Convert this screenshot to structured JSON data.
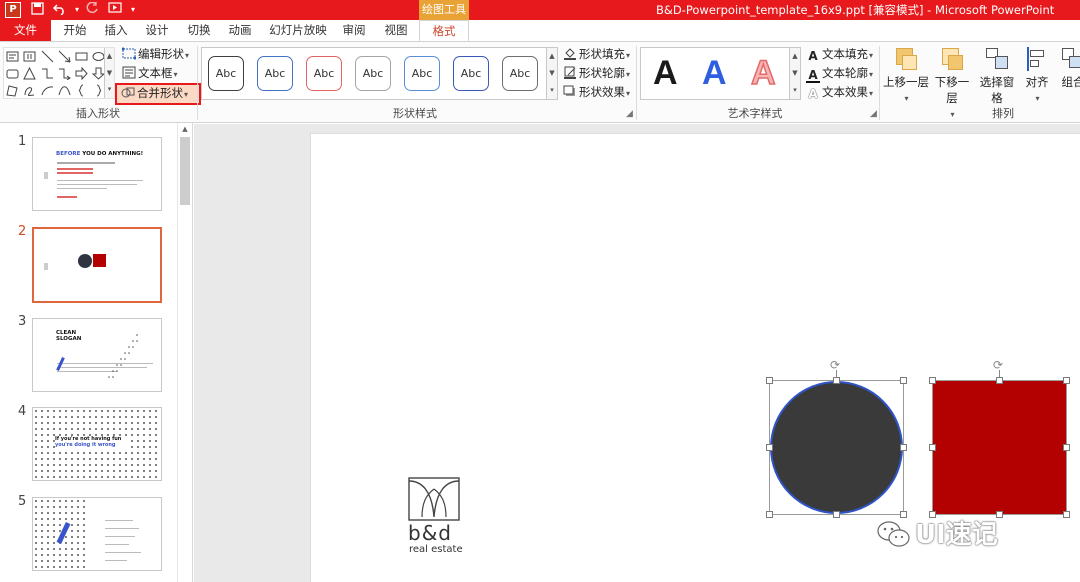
{
  "app": {
    "logo_letter": "P",
    "window_title": "B&D-Powerpoint_template_16x9.ppt [兼容模式] - Microsoft PowerPoint",
    "context_tab_group": "绘图工具"
  },
  "tabs": [
    {
      "label": "文件",
      "active": false
    },
    {
      "label": "开始",
      "active": false
    },
    {
      "label": "插入",
      "active": false
    },
    {
      "label": "设计",
      "active": false
    },
    {
      "label": "切换",
      "active": false
    },
    {
      "label": "动画",
      "active": false
    },
    {
      "label": "幻灯片放映",
      "active": false
    },
    {
      "label": "审阅",
      "active": false
    },
    {
      "label": "视图",
      "active": false
    },
    {
      "label": "格式",
      "active": true
    }
  ],
  "ribbon": {
    "insert_shapes": {
      "label": "插入形状",
      "edit_shape": "编辑形状",
      "text_box": "文本框",
      "merge_shapes": "合并形状"
    },
    "shape_styles": {
      "label": "形状样式",
      "presets": [
        "Abc",
        "Abc",
        "Abc",
        "Abc",
        "Abc",
        "Abc",
        "Abc"
      ],
      "preset_colors": [
        "#404040",
        "#4472c4",
        "#e06666",
        "#a5a5a5",
        "#5b8dd6",
        "#3a58b5",
        "#6f6f6f"
      ],
      "fill": "形状填充",
      "outline": "形状轮廓",
      "effects": "形状效果"
    },
    "wordart_styles": {
      "label": "艺术字样式",
      "letters": [
        "A",
        "A",
        "A"
      ],
      "letter_colors": [
        "#1a1a1a",
        "#2f5fe0",
        "#e46a6a"
      ],
      "text_fill": "文本填充",
      "text_outline": "文本轮廓",
      "text_effects": "文本效果"
    },
    "arrange": {
      "label": "排列",
      "bring_forward": "上移一层",
      "send_backward": "下移一层",
      "selection_pane": "选择窗格",
      "align": "对齐",
      "group": "组合"
    }
  },
  "slides": [
    {
      "number": "1",
      "title_black": "BEFORE",
      "title_blue": "YOU DO ANYTHING!"
    },
    {
      "number": "2"
    },
    {
      "number": "3",
      "title": "CLEAN SLOGAN"
    },
    {
      "number": "4",
      "line1": "If you're not having fun",
      "line2": "you're doing it wrong"
    },
    {
      "number": "5"
    }
  ],
  "canvas": {
    "circle_color": "#3a3a3a",
    "square_color": "#b30000",
    "selection_outline_color": "#2f55c7",
    "logo_name": "b&d",
    "logo_tagline": "real estate"
  },
  "watermark": "UI速记"
}
